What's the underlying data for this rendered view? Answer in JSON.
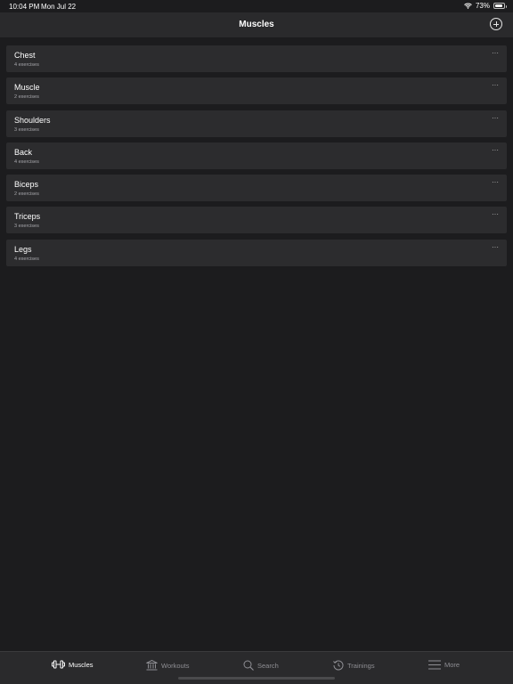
{
  "status": {
    "time": "10:04 PM",
    "date": "Mon Jul 22",
    "battery": "73%"
  },
  "nav": {
    "title": "Muscles",
    "add_icon": "plus-circle-icon"
  },
  "muscles": [
    {
      "name": "Chest",
      "count": "4 exercises"
    },
    {
      "name": "Muscle",
      "count": "2 exercises"
    },
    {
      "name": "Shoulders",
      "count": "3 exercises"
    },
    {
      "name": "Back",
      "count": "4 exercises"
    },
    {
      "name": "Biceps",
      "count": "2 exercises"
    },
    {
      "name": "Triceps",
      "count": "3 exercises"
    },
    {
      "name": "Legs",
      "count": "4 exercises"
    }
  ],
  "more_glyph": "···",
  "tabs": [
    {
      "label": "Muscles",
      "icon": "dumbbell-icon",
      "active": true
    },
    {
      "label": "Workouts",
      "icon": "building-columns-icon",
      "active": false
    },
    {
      "label": "Search",
      "icon": "search-icon",
      "active": false
    },
    {
      "label": "Trainings",
      "icon": "history-icon",
      "active": false
    },
    {
      "label": "More",
      "icon": "menu-icon",
      "active": false
    }
  ],
  "colors": {
    "background": "#1c1c1e",
    "row": "#2c2c2e",
    "bar": "#2a2a2c",
    "inactive": "#8e8e93",
    "active": "#ffffff"
  }
}
